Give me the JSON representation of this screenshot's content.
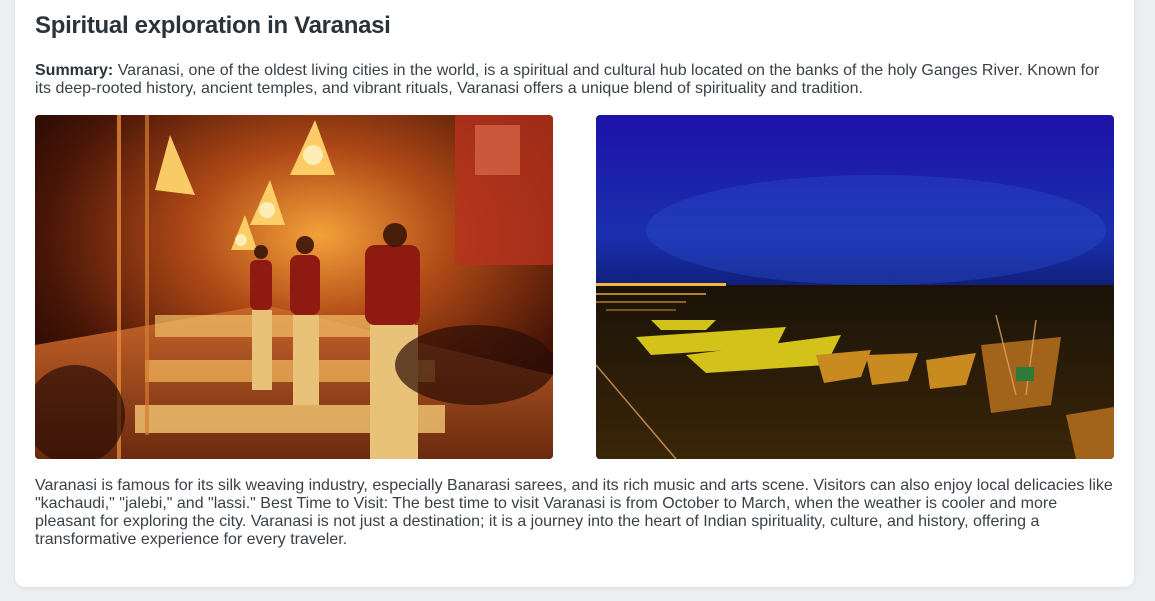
{
  "article": {
    "title": "Spiritual exploration in Varanasi",
    "summary_label": "Summary:",
    "summary_text": " Varanasi, one of the oldest living cities in the world, is a spiritual and cultural hub located on the banks of the holy Ganges River. Known for its deep-rooted history, ancient temples, and vibrant rituals, Varanasi offers a unique blend of spirituality and tradition.",
    "body": "Varanasi is famous for its silk weaving industry, especially Banarasi sarees, and its rich music and arts scene. Visitors can also enjoy local delicacies like \"kachaudi,\" \"jalebi,\" and \"lassi.\" Best Time to Visit: The best time to visit Varanasi is from October to March, when the weather is cooler and more pleasant for exploring the city. Varanasi is not just a destination; it is a journey into the heart of Indian spirituality, culture, and history, offering a transformative experience for every traveler."
  },
  "images": {
    "left_subject": "ganga-aarti-ceremony",
    "right_subject": "boats-on-ganges-at-night"
  },
  "colors": {
    "page_bg": "#eceff1",
    "card_bg": "#ffffff",
    "title": "#2b3338",
    "text": "#3a4046"
  }
}
